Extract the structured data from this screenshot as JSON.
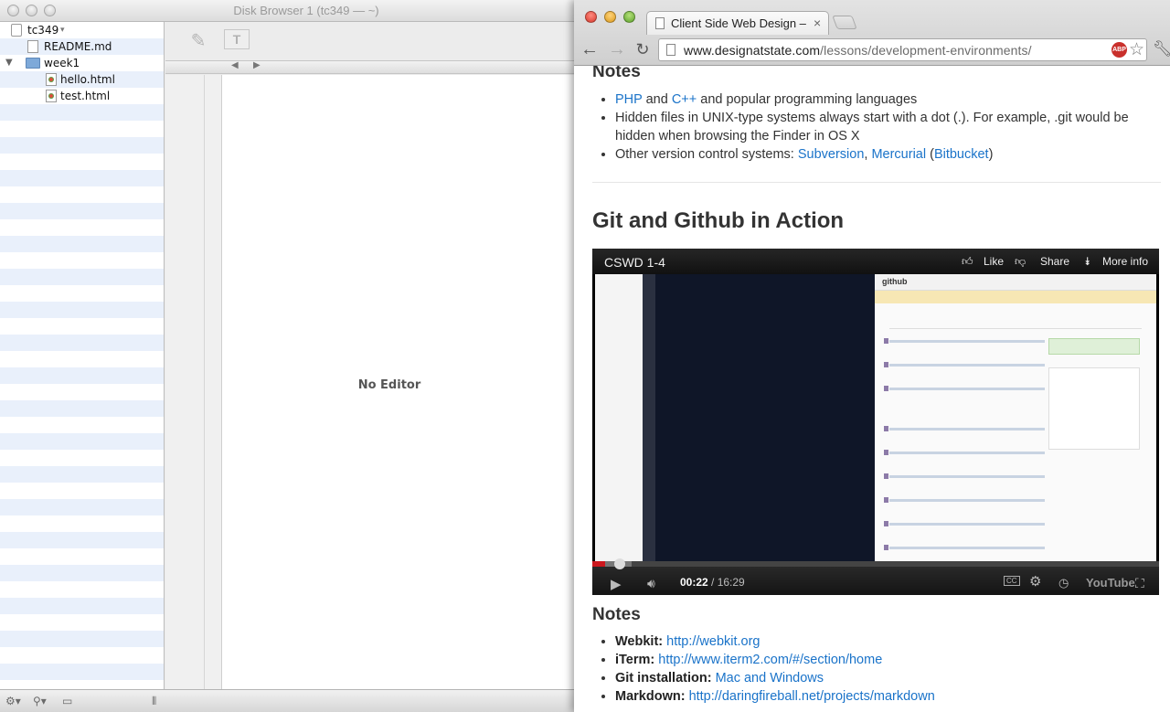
{
  "disk_browser": {
    "title": "Disk Browser 1 (tc349 — ~)",
    "root_label": "tc349",
    "files": [
      {
        "name": "README.md"
      },
      {
        "name": "week1"
      },
      {
        "name": "hello.html"
      },
      {
        "name": "test.html"
      }
    ],
    "editor_placeholder": "No Editor"
  },
  "browser": {
    "tab_title": "Client Side Web Design – TC",
    "url_host": "www.designatstate.com",
    "url_path": "/lessons/development-environments/",
    "abp_label": "ABP",
    "top_notes": {
      "heading": "Notes",
      "item1": {
        "link1": "PHP",
        "mid": " and ",
        "link2": "C++",
        "rest": " and popular programming languages"
      },
      "item2": "Hidden files in UNIX-type systems always start with a dot (.). For example, .git would be hidden when browsing the Finder in OS X",
      "item3": {
        "prefix": "Other version control systems: ",
        "link1": "Subversion",
        "sep": ", ",
        "link2": "Mercurial",
        "open": " (",
        "link3": "Bitbucket",
        "close": ")"
      }
    },
    "section_heading": "Git and Github in Action",
    "video": {
      "title": "CSWD 1-4",
      "actions": [
        "Like",
        "Share",
        "More info"
      ],
      "current_time": "00:22",
      "total_time": " / 16:29",
      "progress": 0.022,
      "buffered": 0.07,
      "brand": "YouTube",
      "github_logo": "github"
    },
    "bottom_notes": {
      "heading": "Notes",
      "items": [
        {
          "label": "Webkit:",
          "link": "http://webkit.org"
        },
        {
          "label": "iTerm:",
          "link": "http://www.iterm2.com/#/section/home"
        },
        {
          "label": "Git installation:",
          "link": "Mac and Windows"
        },
        {
          "label": "Markdown:",
          "link": "http://daringfireball.net/projects/markdown"
        }
      ]
    }
  }
}
